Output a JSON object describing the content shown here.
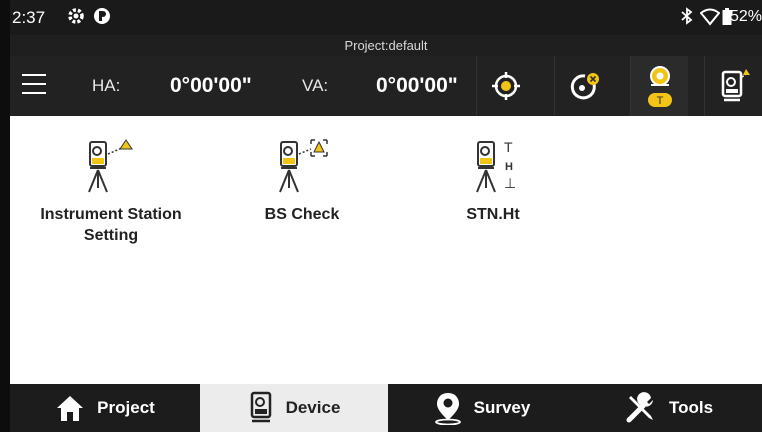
{
  "status": {
    "time": "2:37",
    "battery": "52%",
    "icons": [
      "gear-icon",
      "notification-icon",
      "bluetooth-icon",
      "wifi-icon",
      "battery-icon"
    ]
  },
  "project": {
    "label": "Project:default"
  },
  "toolbar": {
    "ha_label": "HA:",
    "ha_value": "0°00'00\"",
    "va_label": "VA:",
    "va_value": "0°00'00\"",
    "buttons": [
      "target-icon",
      "prism-icon",
      "face-t-icon",
      "instrument-icon"
    ],
    "active_button_badge": "T",
    "accent": "#f2c418"
  },
  "tiles": [
    {
      "label": "Instrument Station\nSetting",
      "icon": "instrument-station-icon"
    },
    {
      "label": "BS Check",
      "icon": "bs-check-icon"
    },
    {
      "label": "STN.Ht",
      "icon": "station-height-icon",
      "height_letters": [
        "T",
        "H",
        "⊥"
      ]
    }
  ],
  "nav": {
    "items": [
      {
        "label": "Project",
        "icon": "home-icon"
      },
      {
        "label": "Device",
        "icon": "device-icon"
      },
      {
        "label": "Survey",
        "icon": "map-pin-icon"
      },
      {
        "label": "Tools",
        "icon": "tools-icon"
      }
    ],
    "active": "Device"
  }
}
